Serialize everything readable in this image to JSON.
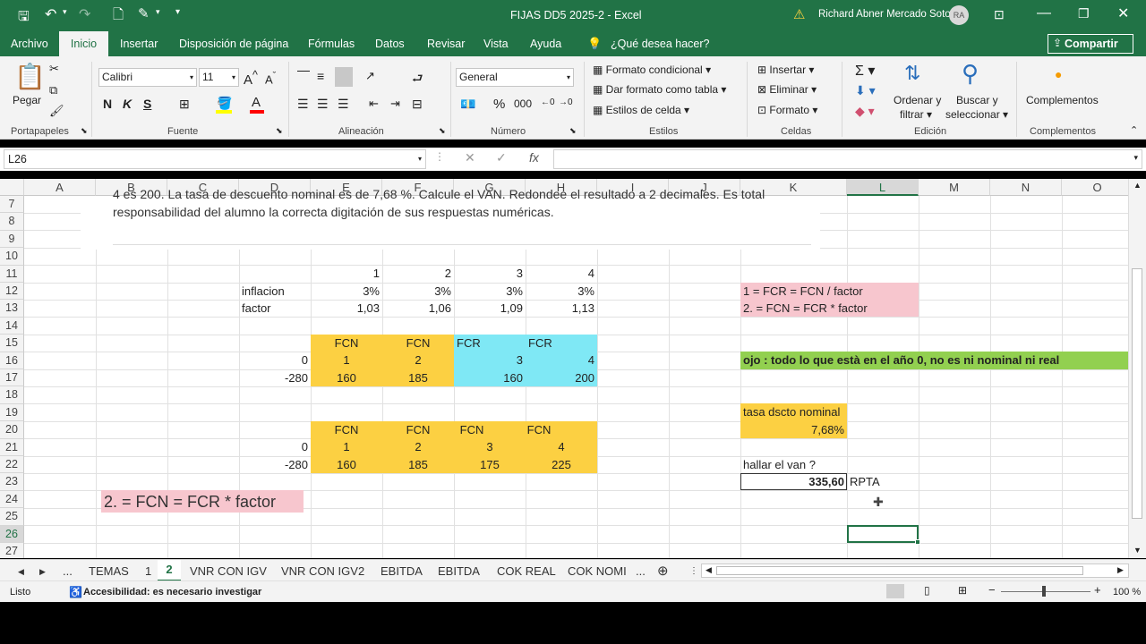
{
  "title": {
    "text": "FIJAS DD5 2025-2  -  Excel",
    "user": "Richard Abner Mercado Soto",
    "avatar": "RA"
  },
  "tabs": [
    "Archivo",
    "Inicio",
    "Insertar",
    "Disposición de página",
    "Fórmulas",
    "Datos",
    "Revisar",
    "Vista",
    "Ayuda",
    "¿Qué desea hacer?"
  ],
  "share": "Compartir",
  "ribbon": {
    "paste": "Pegar",
    "group_clipboard": "Portapapeles",
    "font_name": "Calibri",
    "font_size": "11",
    "bold": "N",
    "italic": "K",
    "underline": "S",
    "group_font": "Fuente",
    "group_align": "Alineación",
    "number_format": "General",
    "group_number": "Número",
    "cond_format": "Formato condicional",
    "table_format": "Dar formato como tabla",
    "cell_styles": "Estilos de celda",
    "group_styles": "Estilos",
    "insert": "Insertar",
    "delete": "Eliminar",
    "format": "Formato",
    "group_cells": "Celdas",
    "sort1": "Ordenar y",
    "sort2": "filtrar",
    "find1": "Buscar y",
    "find2": "seleccionar",
    "group_edit": "Edición",
    "addins": "Complementos",
    "group_addins": "Complementos"
  },
  "formula_bar": {
    "name_box": "L26",
    "fx": "fx",
    "content": ""
  },
  "columns": [
    "A",
    "B",
    "C",
    "D",
    "E",
    "F",
    "G",
    "H",
    "I",
    "J",
    "K",
    "L",
    "M",
    "N",
    "O"
  ],
  "rows": [
    "7",
    "8",
    "9",
    "10",
    "11",
    "12",
    "13",
    "14",
    "15",
    "16",
    "17",
    "18",
    "19",
    "20",
    "21",
    "22",
    "23",
    "24",
    "25",
    "26",
    "27"
  ],
  "image_text": {
    "line1": "4 es 200. La tasa de descuento nominal es de 7,68 %. Calcule el VAN. Redondee el resultado a 2 decimales. Es total",
    "line2": "responsabilidad del alumno la correcta digitación de sus respuestas numéricas."
  },
  "cells": {
    "e11": "1",
    "f11": "2",
    "g11": "3",
    "h11": "4",
    "d12": "inflacion",
    "e12": "3%",
    "f12": "3%",
    "g12": "3%",
    "h12": "3%",
    "d13": "factor",
    "e13": "1,03",
    "f13": "1,06",
    "g13": "1,09",
    "h13": "1,13",
    "e15": "FCN",
    "f15": "FCN",
    "g15": "FCR",
    "h15": "FCR",
    "d16": "0",
    "e16": "1",
    "f16": "2",
    "g16": "3",
    "h16": "4",
    "d17": "-280",
    "e17": "160",
    "f17": "185",
    "g17": "160",
    "h17": "200",
    "e20": "FCN",
    "f20": "FCN",
    "g20": "FCN",
    "h20": "FCN",
    "d21": "0",
    "e21": "1",
    "f21": "2",
    "g21": "3",
    "h21": "4",
    "d22": "-280",
    "e22": "160",
    "f22": "185",
    "g22": "175",
    "h22": "225",
    "k12": "1 = FCR = FCN / factor",
    "k13": "2. = FCN = FCR * factor",
    "k16": "ojo : todo lo que està en el año 0, no es ni nominal ni real",
    "k19": "tasa dscto nominal",
    "k20": "7,68%",
    "k22": "hallar el van ?",
    "k23": "335,60",
    "l23": "RPTA",
    "b24": "2. = FCN = FCR * factor"
  },
  "sheet_tabs": [
    "...",
    "TEMAS",
    "1",
    "2",
    "VNR CON IGV",
    "VNR CON IGV2",
    "EBITDA",
    "EBITDA",
    "COK REAL",
    "COK NOMI",
    "..."
  ],
  "status": {
    "ready": "Listo",
    "accessibility": "Accesibilidad: es necesario investigar",
    "zoom": "100 %"
  },
  "colors": {
    "accent": "#217346",
    "yellow": "#fcd042",
    "cyan": "#7fe8f5",
    "pink": "#f7c6ce",
    "green": "#92d050"
  }
}
